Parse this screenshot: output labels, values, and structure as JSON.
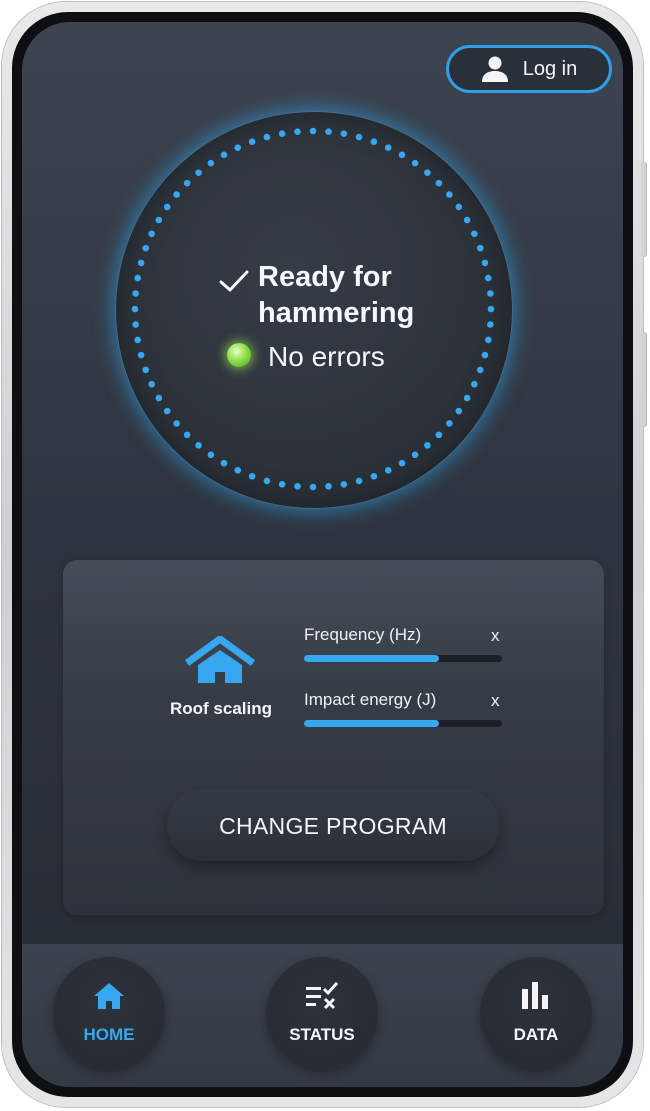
{
  "header": {
    "login_label": "Log in"
  },
  "status": {
    "title_line1": "Ready for",
    "title_line2": "hammering",
    "errors_text": "No errors"
  },
  "program": {
    "mode_label": "Roof scaling",
    "params": [
      {
        "label": "Frequency (Hz)",
        "value": "x",
        "level": 0.68
      },
      {
        "label": "Impact energy (J)",
        "value": "x",
        "level": 0.68
      }
    ],
    "change_button": "CHANGE PROGRAM"
  },
  "nav": {
    "items": [
      {
        "label": "HOME",
        "icon": "home-icon",
        "active": true
      },
      {
        "label": "STATUS",
        "icon": "checklist-icon",
        "active": false
      },
      {
        "label": "DATA",
        "icon": "bar-chart-icon",
        "active": false
      }
    ]
  },
  "colors": {
    "accent": "#37a7f0",
    "led_green": "#8fe04a",
    "background": "#2f3540"
  }
}
